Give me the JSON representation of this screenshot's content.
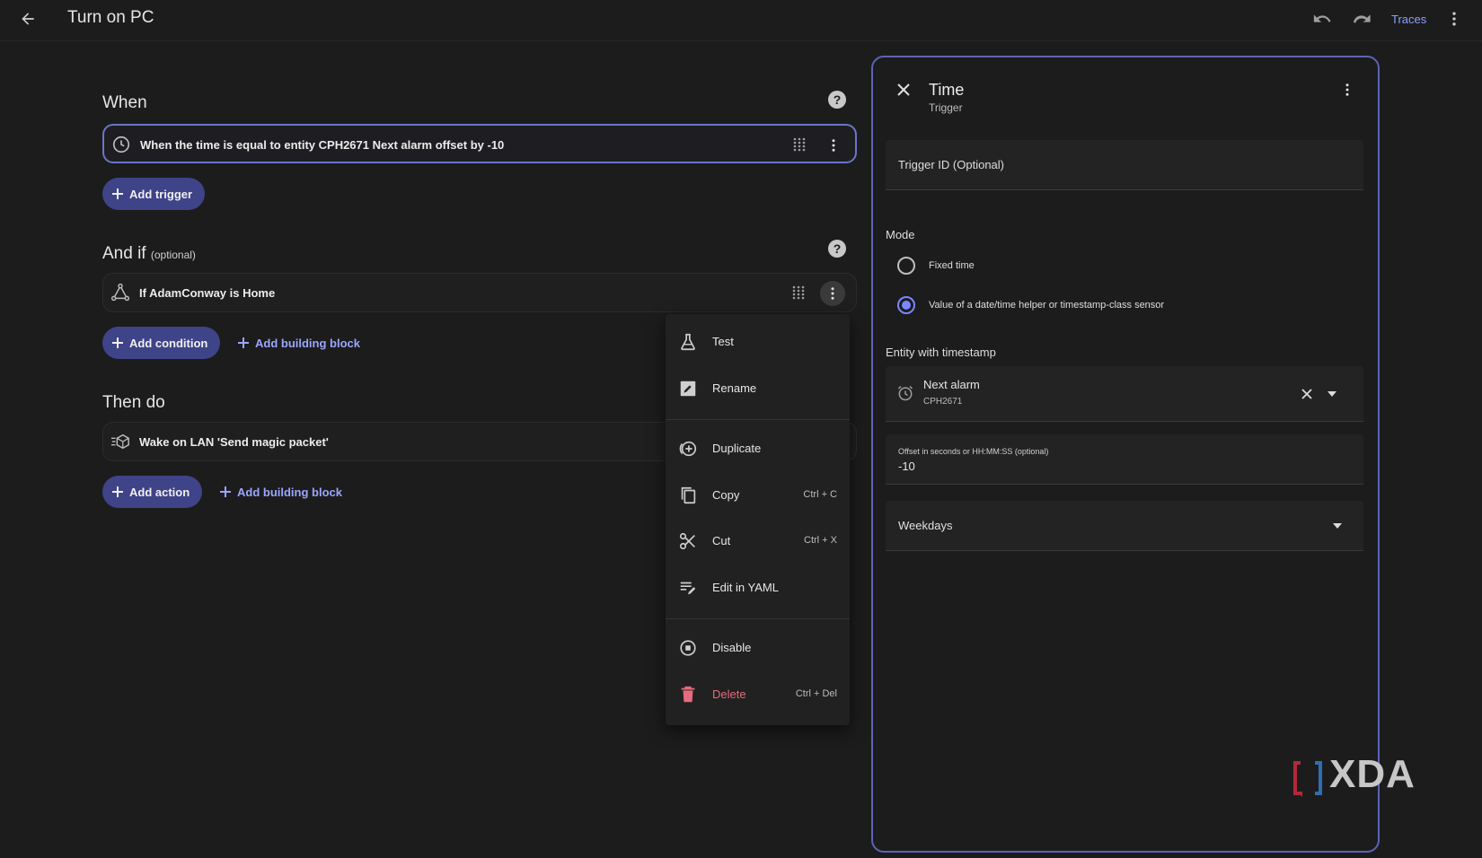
{
  "app": {
    "title": "Turn on PC",
    "traces_label": "Traces"
  },
  "when": {
    "heading": "When",
    "trigger_text": "When the time is equal to entity CPH2671 Next alarm offset by -10",
    "add_trigger": "Add trigger"
  },
  "and_if": {
    "heading": "And if",
    "optional": "(optional)",
    "condition_text": "If AdamConway is Home",
    "add_condition": "Add condition",
    "add_building_block": "Add building block"
  },
  "then_do": {
    "heading": "Then do",
    "action_text": "Wake on LAN 'Send magic packet'",
    "add_action": "Add action",
    "add_building_block": "Add building block"
  },
  "context_menu": {
    "items": [
      {
        "label": "Test",
        "shortcut": "",
        "icon": "flask-icon"
      },
      {
        "label": "Rename",
        "shortcut": "",
        "icon": "rename-icon"
      },
      {
        "label": "Duplicate",
        "shortcut": "",
        "icon": "duplicate-icon"
      },
      {
        "label": "Copy",
        "shortcut": "Ctrl + C",
        "icon": "copy-icon"
      },
      {
        "label": "Cut",
        "shortcut": "Ctrl + X",
        "icon": "scissors-icon"
      },
      {
        "label": "Edit in YAML",
        "shortcut": "",
        "icon": "edit-yaml-icon"
      },
      {
        "label": "Disable",
        "shortcut": "",
        "icon": "disable-icon"
      },
      {
        "label": "Delete",
        "shortcut": "Ctrl + Del",
        "icon": "trash-icon"
      }
    ],
    "delete_color": "#e56c7c"
  },
  "panel": {
    "title": "Time",
    "subtitle": "Trigger",
    "trigger_id_label": "Trigger ID (Optional)",
    "mode_label": "Mode",
    "mode_options": [
      "Fixed time",
      "Value of a date/time helper or timestamp-class sensor"
    ],
    "mode_selected": 1,
    "entity_label": "Entity with timestamp",
    "entity_name": "Next alarm",
    "entity_device": "CPH2671",
    "offset_label": "Offset in seconds or HH:MM:SS (optional)",
    "offset_value": "-10",
    "weekdays_label": "Weekdays"
  },
  "colors": {
    "accent": "#6b74c9",
    "pill": "#3f4388",
    "link": "#9aa6ff"
  },
  "watermark": "XDA"
}
